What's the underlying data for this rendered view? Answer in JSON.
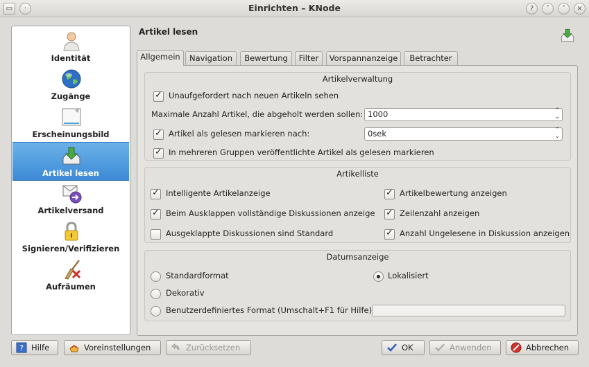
{
  "window": {
    "title": "Einrichten – KNode"
  },
  "sidebar": {
    "items": [
      {
        "label": "Identität",
        "icon": "person-icon"
      },
      {
        "label": "Zugänge",
        "icon": "globe-icon"
      },
      {
        "label": "Erscheinungsbild",
        "icon": "appearance-icon"
      },
      {
        "label": "Artikel lesen",
        "icon": "download-tray-icon",
        "selected": true
      },
      {
        "label": "Artikelversand",
        "icon": "mail-send-icon"
      },
      {
        "label": "Signieren/Verifizieren",
        "icon": "lock-icon"
      },
      {
        "label": "Aufräumen",
        "icon": "broom-icon"
      }
    ]
  },
  "page": {
    "title": "Artikel lesen"
  },
  "tabs": [
    "Allgemein",
    "Navigation",
    "Bewertung",
    "Filter",
    "Vorspannanzeige",
    "Betrachter"
  ],
  "artikelverwaltung": {
    "title": "Artikelverwaltung",
    "auto_check_label": "Unaufgefordert nach neuen Artikeln sehen",
    "max_articles_label": "Maximale Anzahl Artikel, die abgeholt werden sollen:",
    "max_articles_value": "1000",
    "mark_read_label": "Artikel als gelesen markieren nach:",
    "mark_read_value": "0sek",
    "crosspost_label": "In mehreren Gruppen veröffentlichte Artikel als gelesen markieren"
  },
  "artikelliste": {
    "title": "Artikelliste",
    "smart_label": "Intelligente Artikelanzeige",
    "expand_label": "Beim Ausklappen vollständige Diskussionen anzeigen",
    "default_expanded_label": "Ausgeklappte Diskussionen sind Standard",
    "score_label": "Artikelbewertung anzeigen",
    "lines_label": "Zeilenzahl anzeigen",
    "unread_label": "Anzahl Ungelesene in Diskussion anzeigen"
  },
  "datumsanzeige": {
    "title": "Datumsanzeige",
    "standard_label": "Standardformat",
    "localized_label": "Lokalisiert",
    "decorative_label": "Dekorativ",
    "custom_label": "Benutzerdefiniertes Format (Umschalt+F1 für Hilfe)",
    "custom_value": ""
  },
  "buttons": {
    "help": "Hilfe",
    "defaults": "Voreinstellungen",
    "reset": "Zurücksetzen",
    "ok": "OK",
    "apply": "Anwenden",
    "cancel": "Abbrechen"
  }
}
